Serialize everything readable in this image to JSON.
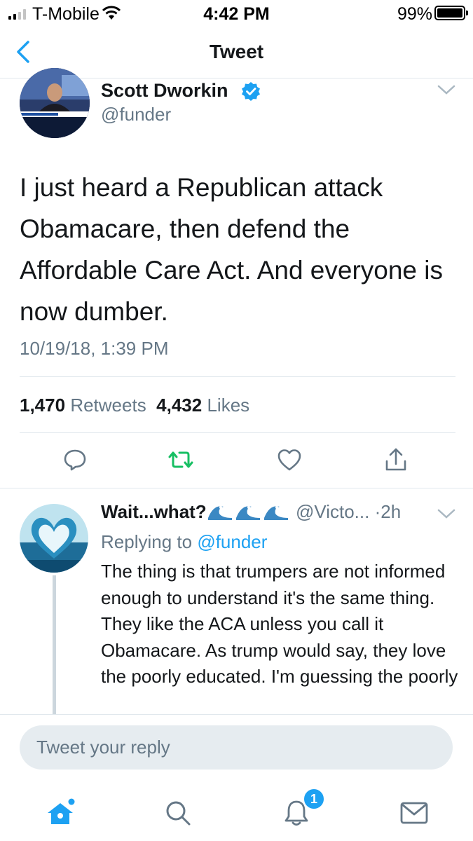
{
  "status_bar": {
    "carrier": "T-Mobile",
    "time": "4:42 PM",
    "battery_percent": "99%",
    "battery_level": 0.99,
    "signal_bars": 2,
    "icons": [
      "signal-icon",
      "wifi-icon",
      "battery-icon"
    ]
  },
  "nav": {
    "title": "Tweet",
    "back_icon": "chevron-left-icon"
  },
  "tweet": {
    "author_name": "Scott Dworkin",
    "verified": true,
    "author_handle": "@funder",
    "text": "I just heard a Republican attack Obamacare, then defend the Affordable Care Act. And everyone is now dumber.",
    "timestamp": "10/19/18, 1:39 PM",
    "retweet_count": "1,470",
    "retweet_label": "Retweets",
    "like_count": "4,432",
    "like_label": "Likes",
    "actions": [
      "reply-icon",
      "retweet-icon",
      "like-icon",
      "share-icon"
    ],
    "colors": {
      "retweet_active": "#17bf63",
      "action_gray": "#657786",
      "link_blue": "#1da1f2"
    }
  },
  "reply": {
    "author_name": "Wait...what?",
    "author_handle": "@Victo...",
    "separator": "·",
    "time_ago": "2h",
    "replying_prefix": "Replying to",
    "replying_to": "@funder",
    "text": "The thing is that trumpers are not informed enough to understand it's the same thing. They like the ACA unless you call it Obamacare. As trump would say, they love the poorly educated. I'm guessing the poorly"
  },
  "compose": {
    "placeholder": "Tweet your reply"
  },
  "tab_bar": {
    "tabs": [
      "home-icon",
      "search-icon",
      "notifications-icon",
      "messages-icon"
    ],
    "notification_count": "1",
    "active_tab": "home"
  }
}
